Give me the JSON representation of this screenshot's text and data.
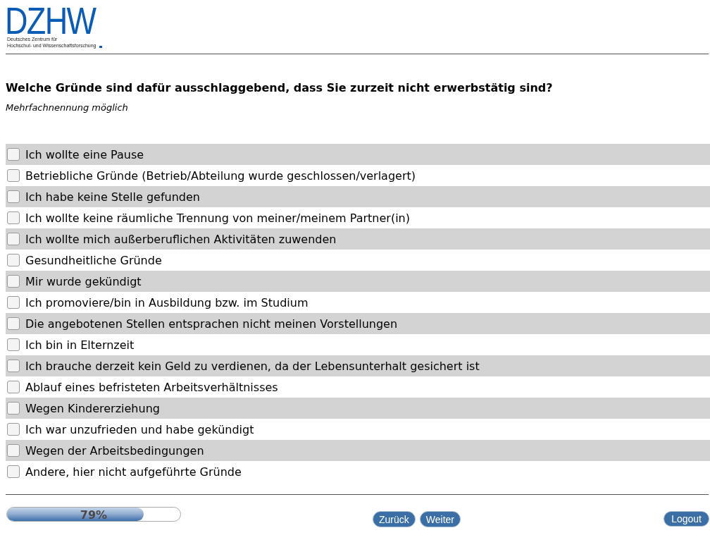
{
  "logo": {
    "wordmark": "DZHW",
    "subtitle_lines": [
      "Deutsches Zentrum für",
      "Hochschul- und Wissenschaftsforschung"
    ]
  },
  "question": {
    "title": "Welche Gründe sind dafür ausschlaggebend, dass Sie zurzeit nicht erwerbstätig sind?",
    "instruction": "Mehrfachnennung möglich"
  },
  "options": [
    {
      "label": "Ich wollte eine Pause",
      "checked": false
    },
    {
      "label": "Betriebliche Gründe (Betrieb/Abteilung wurde geschlossen/verlagert)",
      "checked": false
    },
    {
      "label": "Ich habe keine Stelle gefunden",
      "checked": false
    },
    {
      "label": "Ich wollte keine räumliche Trennung von meiner/meinem Partner(in)",
      "checked": false
    },
    {
      "label": "Ich wollte mich außerberuflichen Aktivitäten zuwenden",
      "checked": false
    },
    {
      "label": "Gesundheitliche Gründe",
      "checked": false
    },
    {
      "label": "Mir wurde gekündigt",
      "checked": false
    },
    {
      "label": "Ich promoviere/bin in Ausbildung bzw. im Studium",
      "checked": false
    },
    {
      "label": "Die angebotenen Stellen entsprachen nicht meinen Vorstellungen",
      "checked": false
    },
    {
      "label": "Ich bin in Elternzeit",
      "checked": false
    },
    {
      "label": "Ich brauche derzeit kein Geld zu verdienen, da der Lebensunterhalt gesichert ist",
      "checked": false
    },
    {
      "label": "Ablauf eines befristeten Arbeitsverhältnisses",
      "checked": false
    },
    {
      "label": "Wegen Kindererziehung",
      "checked": false
    },
    {
      "label": "Ich war unzufrieden und habe gekündigt",
      "checked": false
    },
    {
      "label": "Wegen der Arbeitsbedingungen",
      "checked": false
    },
    {
      "label": "Andere, hier nicht aufgeführte Gründe",
      "checked": false
    }
  ],
  "progress": {
    "level": 0.79,
    "reading": "79%"
  },
  "navigation": [
    {
      "label": "Zurück"
    },
    {
      "label": "Weiter"
    }
  ],
  "logout": {
    "label": "Logout"
  }
}
